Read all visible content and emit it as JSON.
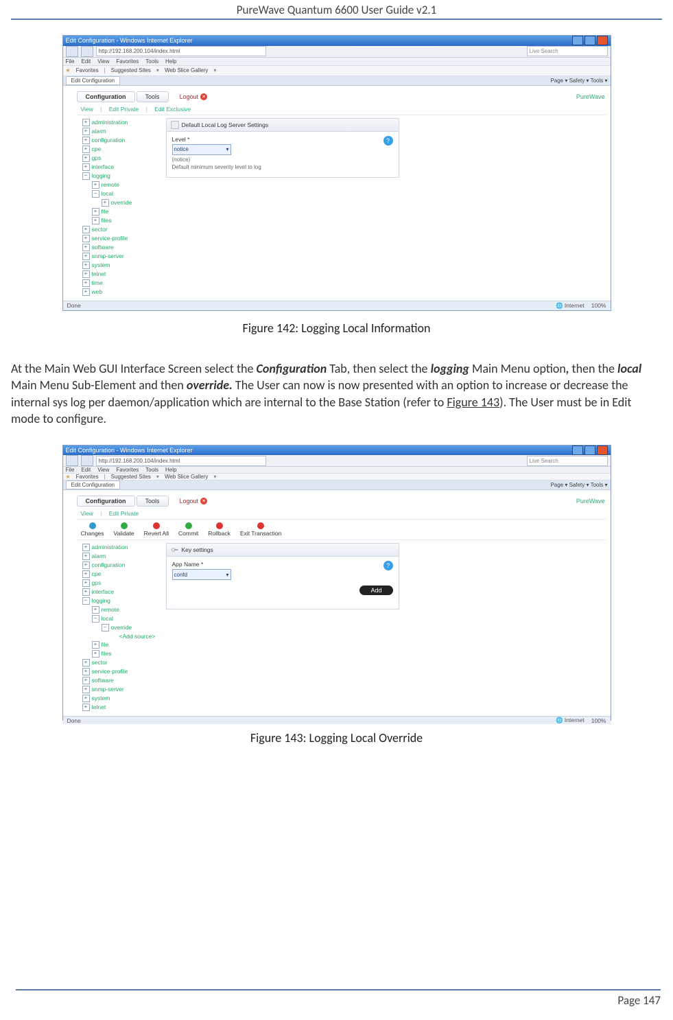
{
  "doc": {
    "header": "PureWave Quantum 6600 User Guide v2.1",
    "page_label": "Page 147"
  },
  "captions": {
    "fig142": "Figure 142: Logging Local Information",
    "fig143": "Figure 143: Logging Local Override"
  },
  "paragraph": {
    "p1_a": "At the Main Web GUI Interface Screen select the ",
    "p1_b": "Configuration",
    "p1_c": " Tab, then select the ",
    "p1_d": "logging",
    "p1_e": " Main Menu option",
    "p1_f": ",",
    "p1_g": " then the ",
    "p1_h": "local",
    "p1_i": " Main Menu Sub-Element and then ",
    "p1_j": "override.",
    "p1_k": " The User can now is now presented with an option to increase or decrease the internal sys log per daemon/application which are internal to the Base Station (refer to ",
    "p1_l": "Figure 143",
    "p1_m": "). The User must be in Edit mode to configure."
  },
  "ie": {
    "title": "Edit Configuration - Windows Internet Explorer",
    "url": "http://192.168.200.104/index.html",
    "search_placeholder": "Live Search",
    "menus": [
      "File",
      "Edit",
      "View",
      "Favorites",
      "Tools",
      "Help"
    ],
    "favorites_label": "Favorites",
    "fav_links": [
      "Suggested Sites",
      "Web Slice Gallery"
    ],
    "tab_label": "Edit Configuration",
    "right_tools": "Page ▾  Safety ▾  Tools ▾",
    "status_done": "Done",
    "status_zone": "Internet",
    "status_zoom": "100%"
  },
  "app": {
    "tabs": {
      "configuration": "Configuration",
      "tools": "Tools"
    },
    "logout": "Logout",
    "brand": "PureWave",
    "subtabs_142": [
      "View",
      "Edit Private",
      "Edit Exclusive"
    ],
    "subtabs_143": [
      "View",
      "Edit Private"
    ],
    "toolbar": {
      "changes": "Changes",
      "validate": "Validate",
      "revert": "Revert All",
      "commit": "Commit",
      "rollback": "Rollback",
      "exit": "Exit Transaction"
    }
  },
  "tree_common": {
    "administration": "administration",
    "alarm": "alarm",
    "configuration": "configuration",
    "cpe": "cpe",
    "gps": "gps",
    "interface": "interface",
    "logging": "logging",
    "remote": "remote",
    "local": "local",
    "override": "override",
    "file": "file",
    "files": "files",
    "sector": "sector",
    "service_profile": "service-profile",
    "software": "software",
    "snmp_server": "snmp-server",
    "system": "system",
    "telnet": "telnet",
    "time": "time",
    "web": "web",
    "add_source": "<Add source>"
  },
  "panel142": {
    "title": "Default Local Log Server Settings",
    "field_label": "Level *",
    "field_value": "notice",
    "current": "(notice)",
    "desc": "Default minimum severity level to log"
  },
  "panel143": {
    "title": "Key settings",
    "field_label": "App Name *",
    "field_value": "confd",
    "add": "Add"
  }
}
